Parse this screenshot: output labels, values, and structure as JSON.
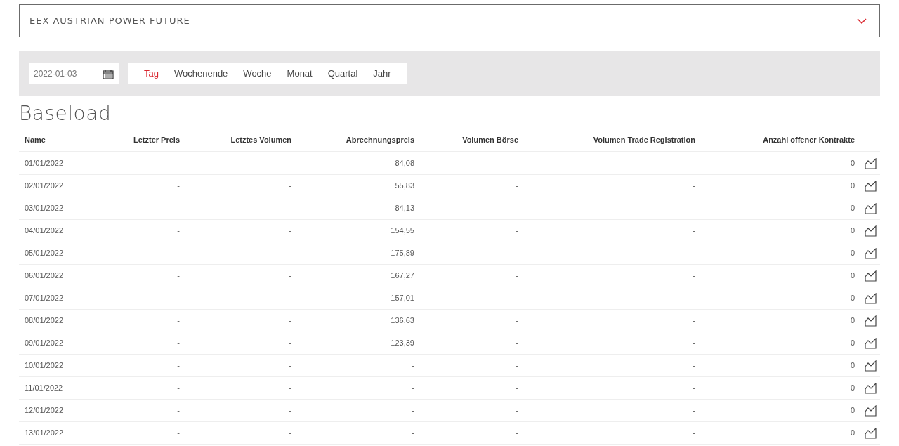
{
  "product": {
    "title": "EEX AUSTRIAN POWER FUTURE",
    "expanded": true
  },
  "filter": {
    "date": "2022-01-03",
    "tabs": [
      {
        "label": "Tag",
        "selected": true
      },
      {
        "label": "Wochenende",
        "selected": false
      },
      {
        "label": "Woche",
        "selected": false
      },
      {
        "label": "Monat",
        "selected": false
      },
      {
        "label": "Quartal",
        "selected": false
      },
      {
        "label": "Jahr",
        "selected": false
      }
    ]
  },
  "section_title": "Baseload",
  "table": {
    "columns": [
      "Name",
      "Letzter Preis",
      "Letztes Volumen",
      "Abrechnungspreis",
      "Volumen Börse",
      "Volumen Trade Registration",
      "Anzahl offener Kontrakte"
    ],
    "rows": [
      [
        "01/01/2022",
        "-",
        "-",
        "84,08",
        "-",
        "-",
        "0"
      ],
      [
        "02/01/2022",
        "-",
        "-",
        "55,83",
        "-",
        "-",
        "0"
      ],
      [
        "03/01/2022",
        "-",
        "-",
        "84,13",
        "-",
        "-",
        "0"
      ],
      [
        "04/01/2022",
        "-",
        "-",
        "154,55",
        "-",
        "-",
        "0"
      ],
      [
        "05/01/2022",
        "-",
        "-",
        "175,89",
        "-",
        "-",
        "0"
      ],
      [
        "06/01/2022",
        "-",
        "-",
        "167,27",
        "-",
        "-",
        "0"
      ],
      [
        "07/01/2022",
        "-",
        "-",
        "157,01",
        "-",
        "-",
        "0"
      ],
      [
        "08/01/2022",
        "-",
        "-",
        "136,63",
        "-",
        "-",
        "0"
      ],
      [
        "09/01/2022",
        "-",
        "-",
        "123,39",
        "-",
        "-",
        "0"
      ],
      [
        "10/01/2022",
        "-",
        "-",
        "-",
        "-",
        "-",
        "0"
      ],
      [
        "11/01/2022",
        "-",
        "-",
        "-",
        "-",
        "-",
        "0"
      ],
      [
        "12/01/2022",
        "-",
        "-",
        "-",
        "-",
        "-",
        "0"
      ],
      [
        "13/01/2022",
        "-",
        "-",
        "-",
        "-",
        "-",
        "0"
      ]
    ]
  }
}
